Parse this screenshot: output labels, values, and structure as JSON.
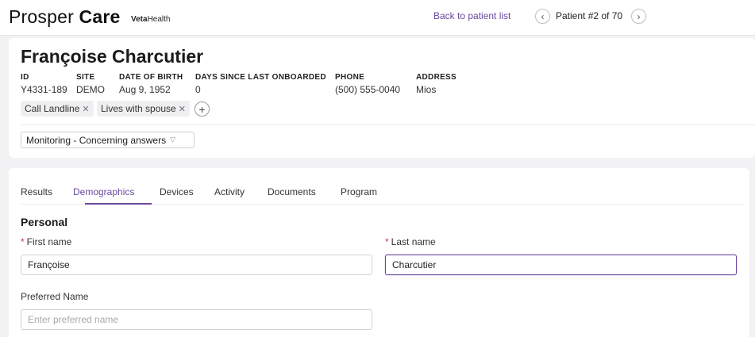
{
  "header": {
    "brand_regular": "Prosper ",
    "brand_bold": "Care",
    "partner_bold": "Veta",
    "partner_regular": "Health",
    "back_link": "Back to patient list",
    "pager_text": "Patient #2 of 70",
    "prev_icon": "chevron-left-icon",
    "next_icon": "chevron-right-icon"
  },
  "patient": {
    "name": "Françoise Charcutier",
    "fields": [
      {
        "label": "ID",
        "value": "Y4331-189"
      },
      {
        "label": "SITE",
        "value": "DEMO"
      },
      {
        "label": "DATE OF BIRTH",
        "value": "Aug 9, 1952"
      },
      {
        "label": "DAYS SINCE LAST ONBOARDED",
        "value": "0"
      },
      {
        "label": "PHONE",
        "value": "(500) 555-0040"
      },
      {
        "label": "ADDRESS",
        "value": "Mios"
      }
    ],
    "tags": [
      "Call Landline",
      "Lives with spouse"
    ],
    "add_tag": "+",
    "status": "Monitoring - Concerning answers"
  },
  "tabs": [
    "Results",
    "Demographics",
    "Devices",
    "Activity",
    "Documents",
    "Program"
  ],
  "active_tab": "Demographics",
  "form": {
    "section_title": "Personal",
    "first_name_label": "First name",
    "first_name_value": "Françoise",
    "last_name_label": "Last name",
    "last_name_value": "Charcutier",
    "preferred_label": "Preferred Name",
    "preferred_placeholder": "Enter preferred name",
    "required_mark": "*"
  },
  "colors": {
    "accent": "#6a4aa0",
    "required": "#d9363e",
    "background": "#f2f2f4"
  }
}
